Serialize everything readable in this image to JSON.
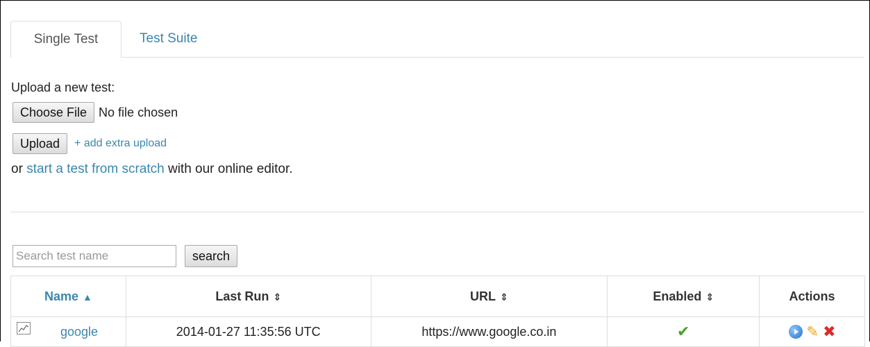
{
  "tabs": [
    {
      "label": "Single Test",
      "active": true
    },
    {
      "label": "Test Suite",
      "active": false
    }
  ],
  "upload": {
    "label": "Upload a new test:",
    "choose_file_label": "Choose File",
    "file_status": "No file chosen",
    "upload_button": "Upload",
    "extra_upload_link": "+ add extra upload"
  },
  "scratch": {
    "prefix": "or ",
    "link": "start a test from scratch",
    "suffix": " with our online editor."
  },
  "search": {
    "placeholder": "Search test name",
    "button": "search"
  },
  "table": {
    "headers": {
      "name": "Name",
      "last_run": "Last Run",
      "url": "URL",
      "enabled": "Enabled",
      "actions": "Actions"
    },
    "sort_icons": {
      "name": "▲",
      "last_run": "⇕",
      "url": "⇕",
      "enabled": "⇕"
    },
    "rows": [
      {
        "name": "google",
        "last_run": "2014-01-27 11:35:56 UTC",
        "url": "https://www.google.co.in",
        "enabled": true
      }
    ]
  },
  "colors": {
    "link": "#3a87ad",
    "enabled_check": "#4aa02c",
    "delete": "#d92b2b",
    "edit": "#e7a21a",
    "run": "#1f6fd0"
  },
  "icons": [
    "chart-icon",
    "check-icon",
    "run-icon",
    "edit-icon",
    "delete-icon"
  ]
}
